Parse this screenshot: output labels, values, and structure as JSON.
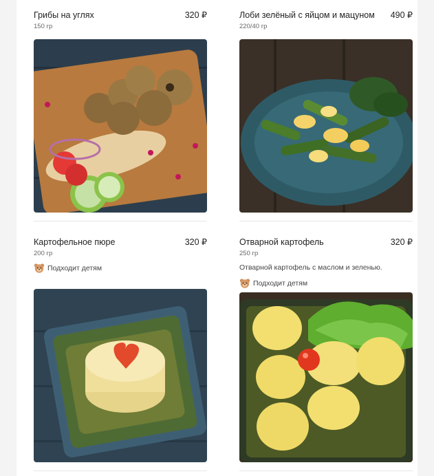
{
  "items": [
    {
      "name": "Грибы на углях",
      "price": "320 ₽",
      "weight": "150 гр",
      "image": "grilled-mushrooms-photo"
    },
    {
      "name": "Лоби зелёный с яйцом и мацуном",
      "price": "490 ₽",
      "weight": "220/40 гр",
      "image": "green-beans-egg-photo"
    },
    {
      "name": "Картофельное пюре",
      "price": "320 ₽",
      "weight": "200 гр",
      "badge": "Подходит детям",
      "badge_icon": "bear-icon",
      "image": "mashed-potatoes-photo"
    },
    {
      "name": "Отварной картофель",
      "price": "320 ₽",
      "weight": "250 гр",
      "description": "Отварной картофель с маслом и зеленью.",
      "badge": "Подходит детям",
      "badge_icon": "bear-icon",
      "image": "boiled-potatoes-photo"
    }
  ],
  "colors": {
    "price": "#222222",
    "muted": "#666666",
    "divider": "#e6e6e6",
    "page": "#ffffff",
    "backdrop": "#f4f4f4"
  }
}
